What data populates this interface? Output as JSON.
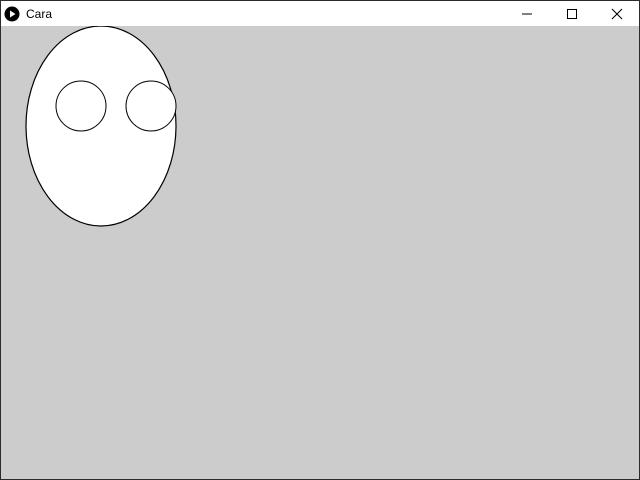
{
  "window": {
    "title": "Cara",
    "app_icon": "play-icon"
  },
  "controls": {
    "minimize_icon": "minimize-icon",
    "maximize_icon": "maximize-icon",
    "close_icon": "close-icon"
  },
  "canvas": {
    "background": "#cccccc",
    "shapes": [
      {
        "name": "face-ellipse",
        "fill": "#ffffff",
        "stroke": "#000000"
      },
      {
        "name": "left-eye-circle",
        "fill": "#ffffff",
        "stroke": "#000000"
      },
      {
        "name": "right-eye-circle",
        "fill": "#ffffff",
        "stroke": "#000000"
      }
    ]
  }
}
